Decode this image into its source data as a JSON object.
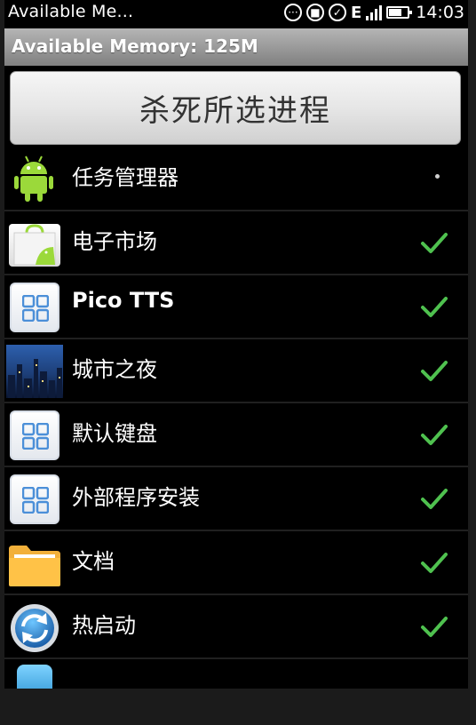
{
  "status_bar": {
    "title": "Available Me...",
    "time": "14:03"
  },
  "title_bar": {
    "text": "Available Memory: 125M"
  },
  "kill_button": {
    "label": "杀死所选进程"
  },
  "colors": {
    "check": "#4fc14f",
    "title_bar": "#9a9a9a",
    "background": "#000000"
  },
  "processes": [
    {
      "label": "任务管理器",
      "icon": "android-robot-icon",
      "selected": false
    },
    {
      "label": "电子市场",
      "icon": "market-bag-icon",
      "selected": true
    },
    {
      "label": "Pico TTS",
      "icon": "default-app-icon",
      "selected": true
    },
    {
      "label": "城市之夜",
      "icon": "city-night-icon",
      "selected": true
    },
    {
      "label": "默认键盘",
      "icon": "default-app-icon",
      "selected": true
    },
    {
      "label": "外部程序安装",
      "icon": "default-app-icon",
      "selected": true
    },
    {
      "label": "文档",
      "icon": "folder-icon",
      "selected": true
    },
    {
      "label": "热启动",
      "icon": "refresh-icon",
      "selected": true
    }
  ]
}
